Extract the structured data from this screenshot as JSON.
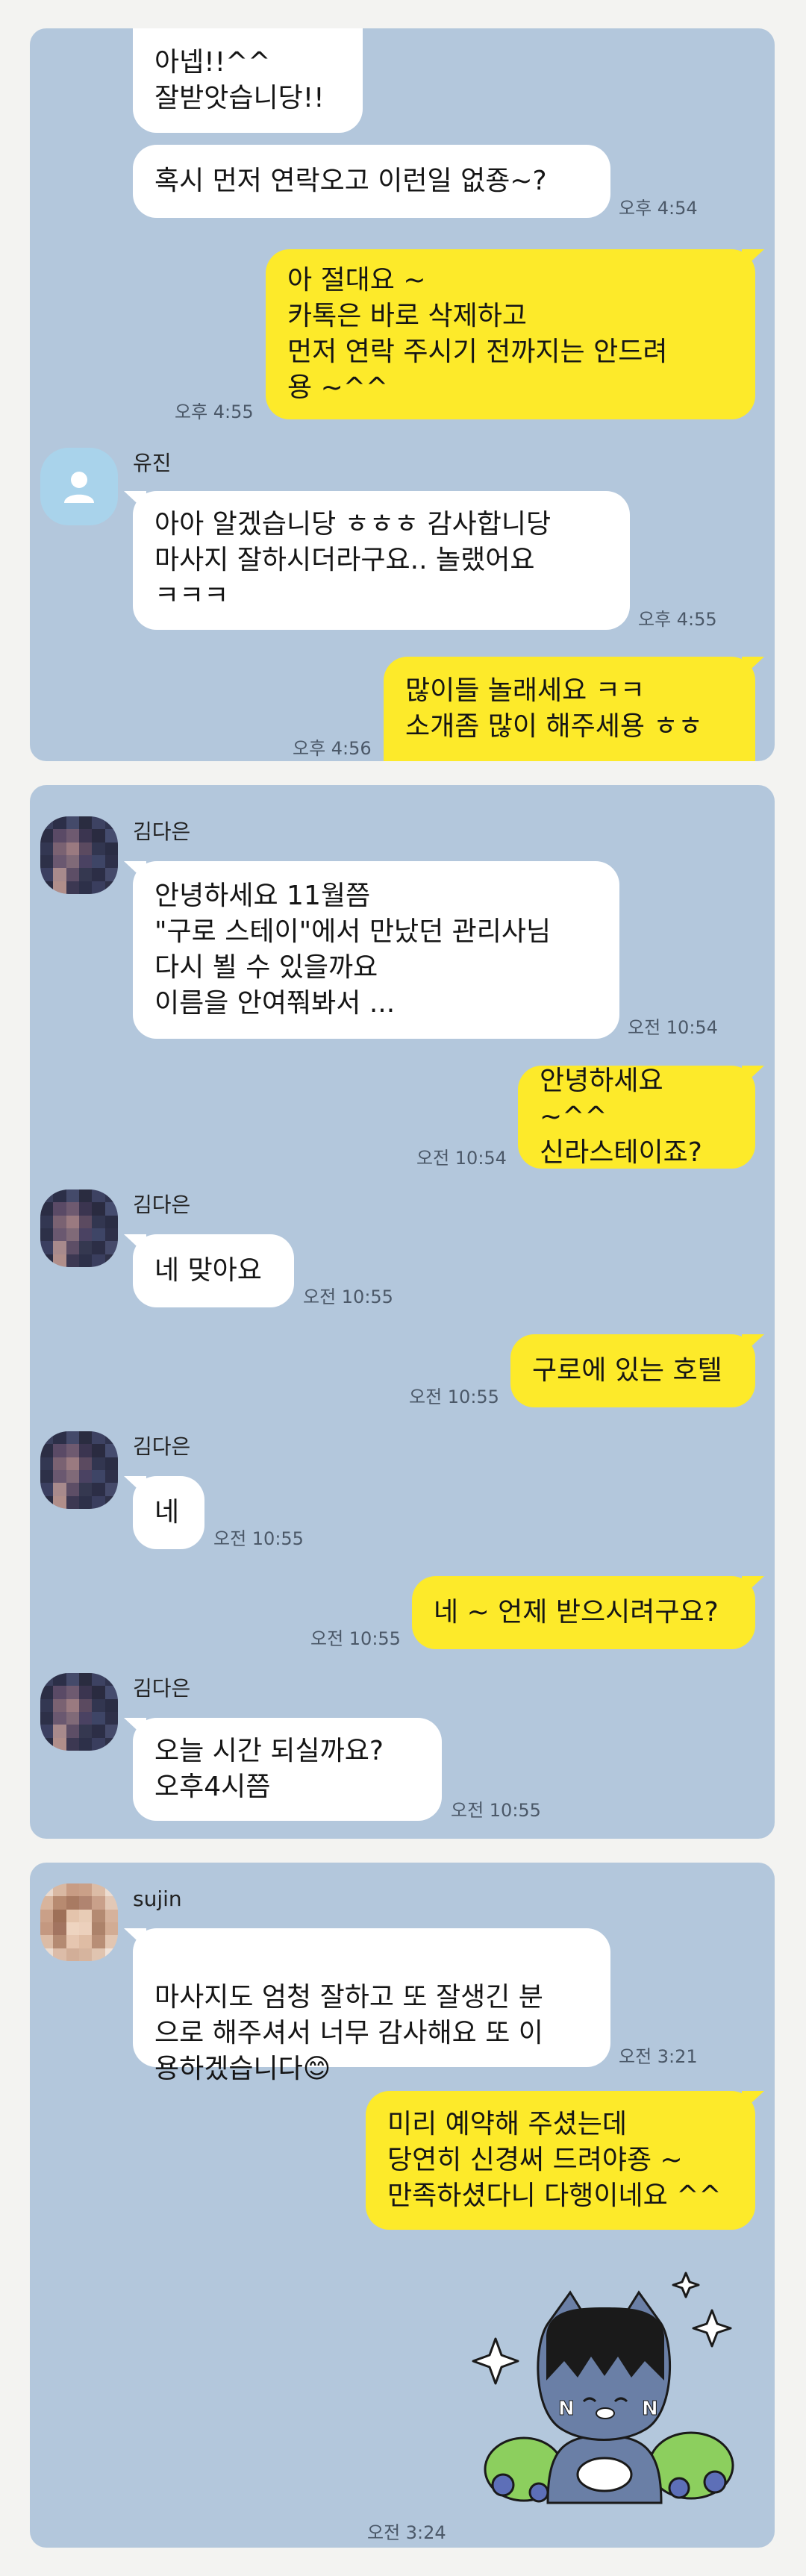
{
  "panel1": {
    "messages": [
      {
        "text": "아넵!!^^\n잘받앗습니당!!"
      },
      {
        "text": "혹시 먼저 연락오고 이런일 없죵~?",
        "time": "오후 4:54"
      },
      {
        "text": "아 절대요 ~\n카톡은 바로 삭제하고\n먼저 연락 주시기 전까지는 안드려\n용 ~^^",
        "time": "오후 4:55"
      },
      {
        "sender": "유진",
        "text": "아아 알겠습니당 ㅎㅎㅎ 감사합니당\n마사지 잘하시더라구요.. 놀랬어요\nㅋㅋㅋ",
        "time": "오후 4:55"
      },
      {
        "text": "많이들 놀래세요 ㅋㅋ\n소개좀 많이 해주세용 ㅎㅎ",
        "time": "오후 4:56"
      }
    ]
  },
  "panel2": {
    "messages": [
      {
        "sender": "김다은",
        "text": "안녕하세요 11월쯤\n\"구로 스테이\"에서 만났던 관리사님\n다시 뵐 수 있을까요\n이름을 안여쭤봐서 ...",
        "time": "오전 10:54"
      },
      {
        "text": "안녕하세요 ~^^\n신라스테이죠?",
        "time": "오전 10:54"
      },
      {
        "sender": "김다은",
        "text": "네 맞아요",
        "time": "오전 10:55"
      },
      {
        "text": "구로에 있는 호텔",
        "time": "오전 10:55"
      },
      {
        "sender": "김다은",
        "text": "네",
        "time": "오전 10:55"
      },
      {
        "text": "네 ~ 언제 받으시려구요?",
        "time": "오전 10:55"
      },
      {
        "sender": "김다은",
        "text": "오늘  시간 되실까요?\n오후4시쯤",
        "time": "오전 10:55"
      }
    ]
  },
  "panel3": {
    "messages": [
      {
        "sender": "sujin",
        "text": "마사지도 엄청 잘하고 또 잘생긴 분\n으로 해주셔서 너무 감사해요 또 이\n용하겠습니다",
        "emoji": "😊",
        "time": "오전 3:21"
      },
      {
        "text": "미리 예약해 주셨는데\n당연히 신경써 드려야죵 ~\n만족하셨다니 다행이네요 ^^"
      },
      {
        "sticker": "kakao-friends-cat-sticker",
        "time": "오전 3:24"
      }
    ]
  },
  "colors": {
    "chat_bg": "#b3c7dc",
    "outgoing_bubble": "#fdea2a",
    "incoming_bubble": "#ffffff",
    "page_bg": "#f3f3f1"
  }
}
